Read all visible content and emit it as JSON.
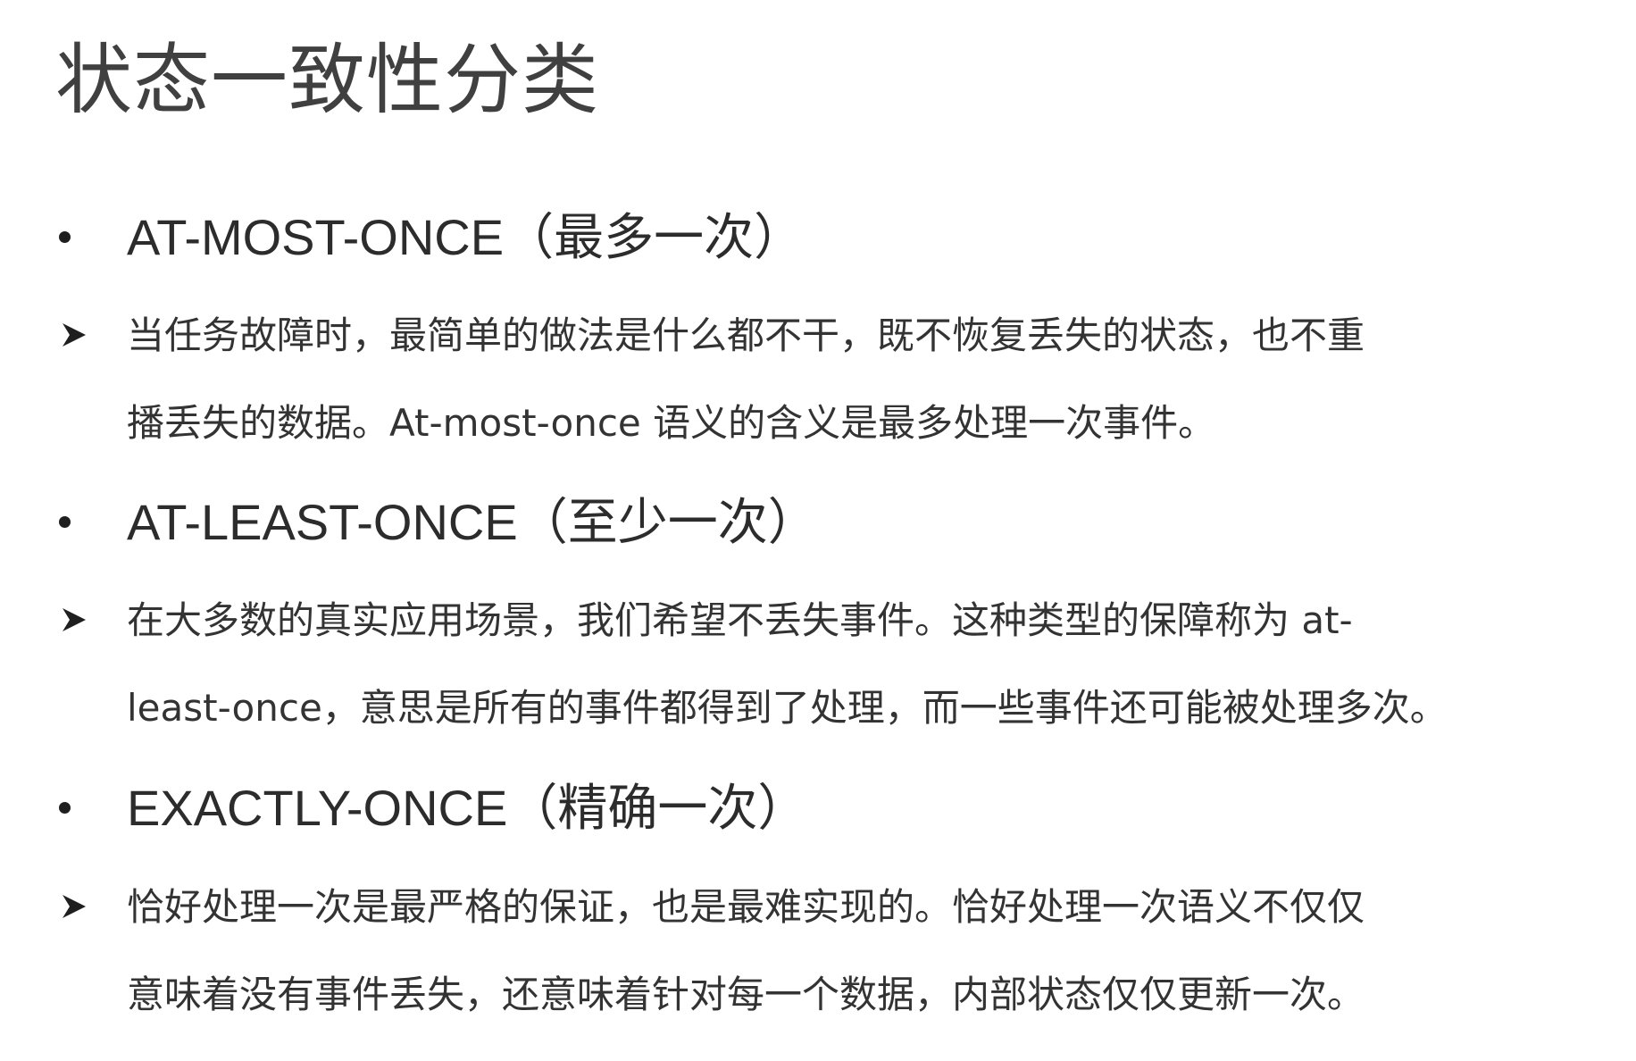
{
  "title": "状态一致性分类",
  "sections": [
    {
      "heading": "AT-MOST-ONCE（最多一次）",
      "lines": [
        "当任务故障时，最简单的做法是什么都不干，既不恢复丢失的状态，也不重",
        "播丢失的数据。At-most-once 语义的含义是最多处理一次事件。"
      ]
    },
    {
      "heading": "AT-LEAST-ONCE（至少一次）",
      "lines": [
        "在大多数的真实应用场景，我们希望不丢失事件。这种类型的保障称为 at-",
        "least-once，意思是所有的事件都得到了处理，而一些事件还可能被处理多次。"
      ]
    },
    {
      "heading": "EXACTLY-ONCE（精确一次）",
      "lines": [
        "恰好处理一次是最严格的保证，也是最难实现的。恰好处理一次语义不仅仅",
        "意味着没有事件丢失，还意味着针对每一个数据，内部状态仅仅更新一次。"
      ]
    }
  ]
}
